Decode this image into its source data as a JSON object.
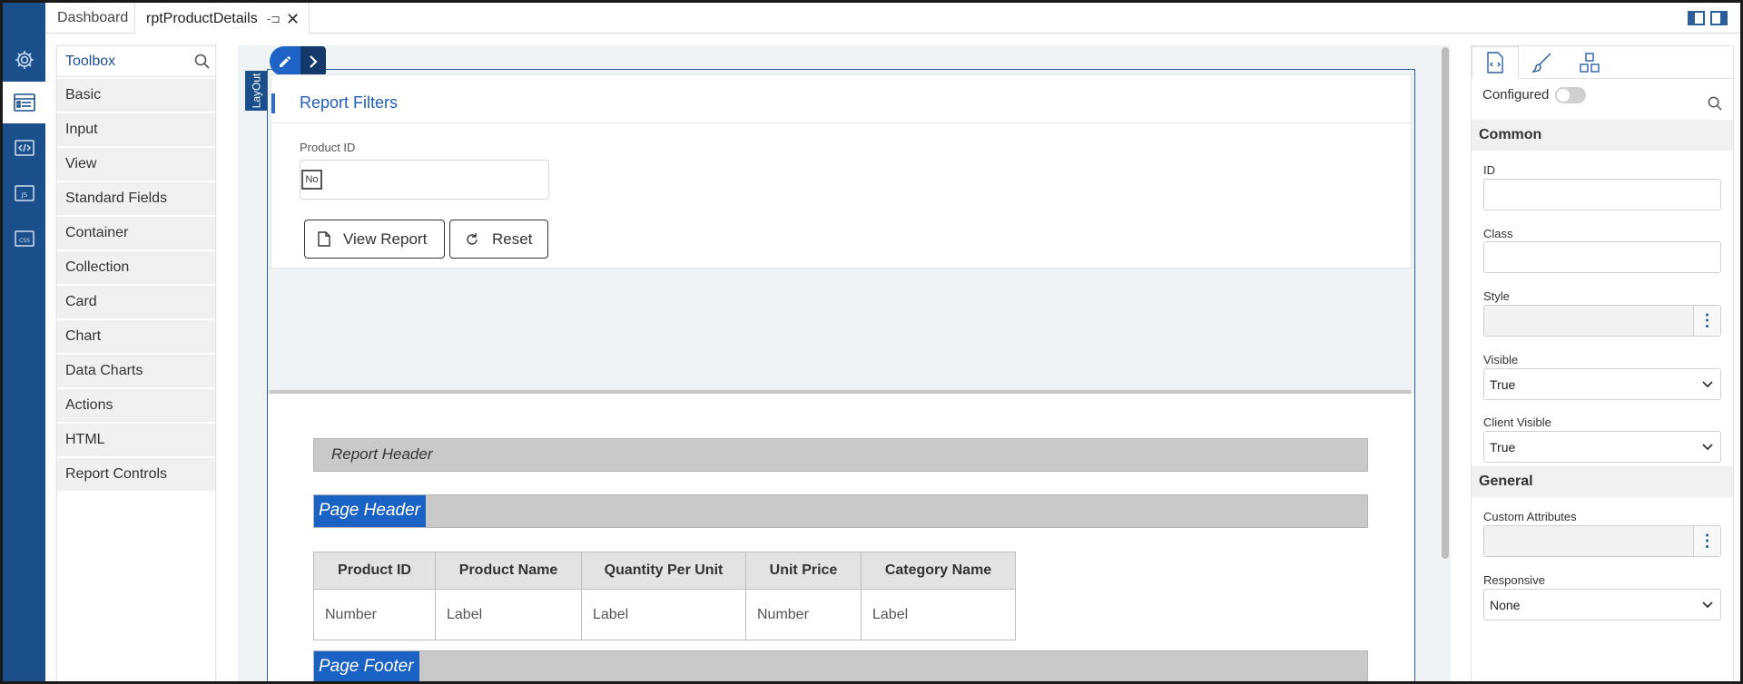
{
  "tabs": {
    "dashboard": "Dashboard",
    "active": "rptProductDetails",
    "pin_icon": "pin-icon",
    "close_icon": "close-icon"
  },
  "rail": {
    "items": [
      "settings-gear-icon",
      "form-designer-icon",
      "code-icon",
      "js-icon",
      "css-icon"
    ],
    "active_index": 1,
    "js_label": "JS",
    "css_label": "CSS"
  },
  "toolbox": {
    "title": "Toolbox",
    "items": [
      "Basic",
      "Input",
      "View",
      "Standard Fields",
      "Container",
      "Collection",
      "Card",
      "Chart",
      "Data Charts",
      "Actions",
      "HTML",
      "Report Controls"
    ]
  },
  "canvas": {
    "layout_tag": "LayOut",
    "filters_title": "Report Filters",
    "product_id_label": "Product ID",
    "product_id_checkbox": "No",
    "view_report_label": "View Report",
    "reset_label": "Reset",
    "report_header": "Report Header",
    "page_header": "Page Header",
    "page_footer": "Page Footer",
    "table": {
      "headers": [
        "Product ID",
        "Product Name",
        "Quantity Per Unit",
        "Unit Price",
        "Category Name"
      ],
      "row": [
        "Number",
        "Label",
        "Label",
        "Number",
        "Label"
      ]
    }
  },
  "props": {
    "configured_label": "Configured",
    "configured_on": false,
    "sections": {
      "common": "Common",
      "general": "General"
    },
    "fields": {
      "id": {
        "label": "ID",
        "value": ""
      },
      "class": {
        "label": "Class",
        "value": ""
      },
      "style": {
        "label": "Style",
        "value": ""
      },
      "visible": {
        "label": "Visible",
        "value": "True"
      },
      "client_visible": {
        "label": "Client Visible",
        "value": "True"
      },
      "custom_attributes": {
        "label": "Custom Attributes",
        "value": ""
      },
      "responsive": {
        "label": "Responsive",
        "value": "None"
      }
    }
  },
  "colors": {
    "rail": "#1a4f8b",
    "accent": "#1a63c5",
    "band": "#c9c9c9"
  }
}
